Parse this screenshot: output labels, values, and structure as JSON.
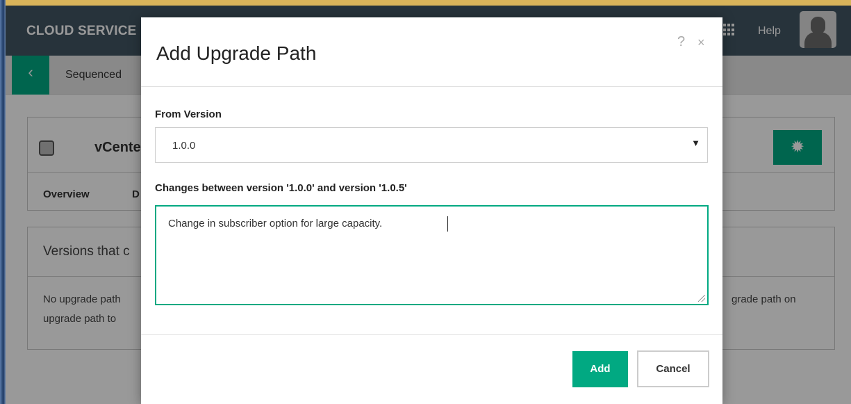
{
  "header": {
    "brand": "CLOUD SERVICE",
    "help_label": "Help",
    "apps_icon": "apps-grid-icon",
    "avatar_icon": "user-avatar-icon"
  },
  "subnav": {
    "back_icon": "chevron-left-icon",
    "back_glyph": "‹",
    "breadcrumb": "Sequenced"
  },
  "service_card": {
    "name": "vCenter",
    "tabs": [
      "Overview",
      "D"
    ],
    "gear_icon": "gear-icon"
  },
  "versions_card": {
    "title": "Versions that c",
    "message_left": "No upgrade path",
    "message_left_line2": "upgrade path to",
    "message_right": "grade path on"
  },
  "dialog": {
    "title": "Add Upgrade Path",
    "help_glyph": "?",
    "close_glyph": "×",
    "from_version_label": "From Version",
    "from_version_value": "1.0.0",
    "changes_label": "Changes between version '1.0.0' and version '1.0.5'",
    "changes_value": "Change in subscriber option for large capacity.",
    "add_button": "Add",
    "cancel_button": "Cancel"
  },
  "colors": {
    "accent": "#01a982",
    "header": "#425563"
  }
}
